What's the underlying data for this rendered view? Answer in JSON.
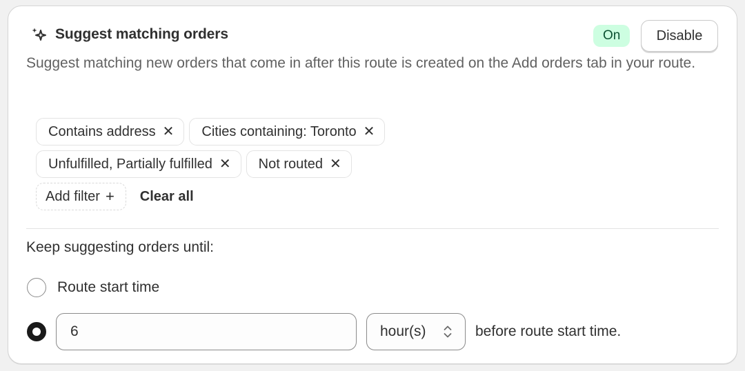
{
  "card": {
    "title": "Suggest matching orders",
    "status_badge": "On",
    "disable_label": "Disable",
    "description": "Suggest matching new orders that come in after this route is created on the Add orders tab in your route."
  },
  "filters": {
    "rows": [
      [
        {
          "label": "Contains address",
          "remove_icon": "close-icon"
        },
        {
          "label": "Cities containing: Toronto",
          "remove_icon": "close-icon"
        }
      ],
      [
        {
          "label": "Unfulfilled, Partially fulfilled",
          "remove_icon": "close-icon"
        },
        {
          "label": "Not routed",
          "remove_icon": "close-icon"
        }
      ]
    ],
    "add_filter_label": "Add filter",
    "clear_all_label": "Clear all"
  },
  "suggest_until": {
    "label": "Keep suggesting orders until:",
    "options": [
      {
        "label": "Route start time",
        "selected": false
      },
      {
        "selected": true
      }
    ],
    "hours_value": "6",
    "unit_value": "hour(s)",
    "after_text": "before route start time."
  },
  "colors": {
    "badge_bg": "#cdfee1",
    "badge_text": "#0c5132",
    "text_primary": "#303030",
    "text_secondary": "#616161"
  },
  "icons": {
    "title_icon": "sparkle-icon",
    "chip_remove": "close-icon",
    "add": "plus-icon",
    "select": "chevron-up-down-icon"
  }
}
